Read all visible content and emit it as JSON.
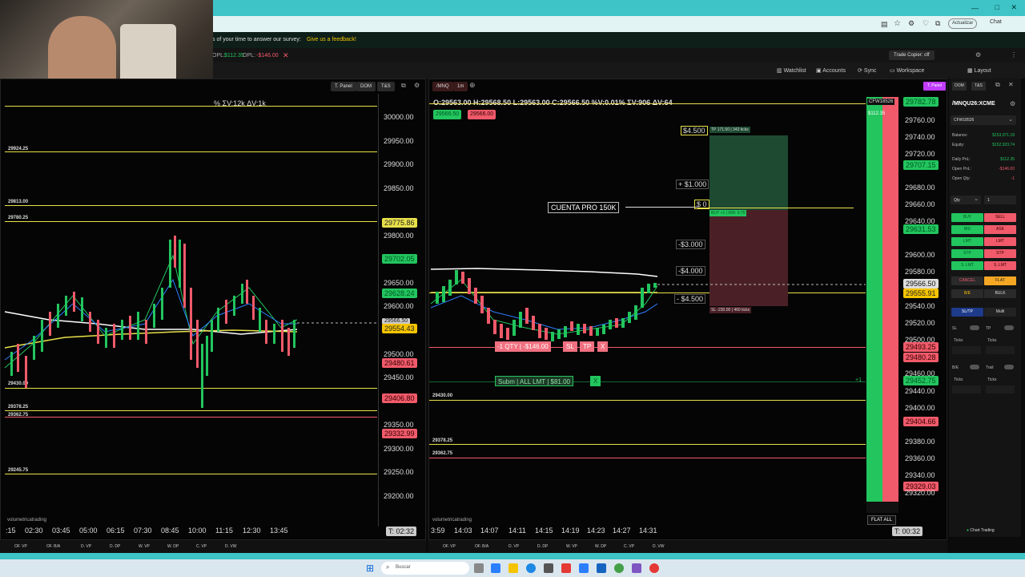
{
  "browser": {
    "update_label": "Actualizar",
    "chat_label": "Chat"
  },
  "banner": {
    "text": "s of your time to answer our survey:",
    "link": "Give us a feedback!"
  },
  "topbar": {
    "opl_label": "OPL:",
    "opl_value": "$112.35",
    "opl2_label": "OPL:",
    "opl2_value": "-$146.00",
    "trade_copier": "Trade Copier: off"
  },
  "nav": {
    "watchlist": "Watchlist",
    "accounts": "Accounts",
    "sync": "Sync",
    "workspace": "Workspace",
    "layout": "Layout"
  },
  "left_chart": {
    "buttons": [
      "T. Panel",
      "DOM",
      "T&S"
    ],
    "info": "% ΣV:12k ΔV:1k",
    "levels": [
      "29924.25",
      "29813.00",
      "29780.25",
      "29430.00",
      "29378.25",
      "29362.75",
      "29245.75"
    ],
    "ticks": [
      "30000.00",
      "29950.00",
      "29900.00",
      "29850.00",
      "29800.00",
      "29750.00",
      "29650.00",
      "29600.00",
      "29500.00",
      "29450.00",
      "29350.00",
      "29300.00",
      "29250.00",
      "29200.00"
    ],
    "tags": {
      "yellow": "29775.86",
      "green": "29702.05",
      "green2": "29628.24",
      "price": "29566.50",
      "gold": "29554.43",
      "red1": "29480.61",
      "red2": "29406.80",
      "red3": "29332.99"
    },
    "times": [
      ":15",
      "02:30",
      "03:45",
      "05:00",
      "06:15",
      "07:30",
      "08:45",
      "10:00",
      "11:15",
      "12:30",
      "13:45"
    ],
    "timer": "T: 02:32",
    "brand": "volumetricatrading",
    "bottom_tabs": [
      "OF. VP",
      "OF. B/A",
      "D. VP",
      "D. DP",
      "W. VP",
      "W. DP",
      "C. VP",
      "D. VW"
    ]
  },
  "right_chart": {
    "symbol": "/MNQ",
    "timeframe": "1m",
    "buttons": [
      "T. Panel",
      "DOM",
      "T&S"
    ],
    "ohlc": "O:29563.00 H:29568.50 L:29563.00 C:29566.50 %V:0.01% ΣV:906 ΔV:64",
    "bid": "29566.50",
    "ask": "29566.00",
    "levels_left": [
      "29430.00",
      "29378.25",
      "29362.75"
    ],
    "pnl_labels": [
      "$4.500",
      "+ $1.000",
      "$ 0",
      "-$3.000",
      "-$4.000",
      "- $4.500"
    ],
    "tp_label": "TP 171.50 | 343 ticks",
    "sl_label": "SL -230.00 | 460 ticks",
    "entry_label": "BUY +1 | R/R: 0.75",
    "account_label": "CUENTA PRO 150K",
    "position": "-1 QTY | -$146.00",
    "sl_btn": "SL",
    "tp_btn": "TP",
    "close_btn": "X",
    "order_label": "Subm | ALL LMT | $81.00",
    "order_close": "X",
    "plus1": "+1",
    "account_tag": "CFW18526",
    "pnl_tag": "$112.35",
    "flat_all": "FLAT ALL",
    "timer": "T: 00:32",
    "ticks": [
      "29760.00",
      "29740.00",
      "29720.00",
      "29680.00",
      "29660.00",
      "29640.00",
      "29600.00",
      "29580.00",
      "29540.00",
      "29520.00",
      "29500.00",
      "29460.00",
      "29440.00",
      "29400.00",
      "29380.00",
      "29360.00",
      "29340.00",
      "29320.00"
    ],
    "tags": {
      "top": "29782.78",
      "t2": "29707.15",
      "t3": "29631.53",
      "price": "29566.50",
      "gold": "29555.91",
      "r1": "29493.25",
      "r2": "29480.28",
      "g1": "29452.75",
      "r3": "29404.66",
      "r4": "29329.03"
    },
    "times": [
      "3:59",
      "14:03",
      "14:07",
      "14:11",
      "14:15",
      "14:19",
      "14:23",
      "14:27",
      "14:31"
    ],
    "brand": "volumetricatrading",
    "bottom_tabs": [
      "OF. VP",
      "OF. B/A",
      "D. VP",
      "D. DP",
      "W. VP",
      "W. DP",
      "C. VP",
      "D. VW"
    ]
  },
  "panel": {
    "buttons": [
      "T. Panel",
      "DOM",
      "T&S"
    ],
    "symbol": "/MNQU26:XCME",
    "account": "CFW18526",
    "rows": [
      {
        "label": "Balance:",
        "value": "$153,071.18"
      },
      {
        "label": "Equity:",
        "value": "$152,923.74"
      },
      {
        "label": "Daily PnL:",
        "value": "$112.35"
      },
      {
        "label": "Open PnL:",
        "value": "-$146.00"
      },
      {
        "label": "Open Qty:",
        "value": "-1"
      }
    ],
    "qty_label": "Qty",
    "qty_value": "1",
    "buy": "BUY",
    "sell": "SELL",
    "bid": "BID",
    "ask": "ASK",
    "lmt1": "LMT",
    "lmt2": "LMT",
    "stp1": "STP",
    "stp2": "STP",
    "slmt1": "S. LMT",
    "slmt2": "S. LMT",
    "cancel": "CANCEL",
    "flat": "FLAT",
    "be": "B/E",
    "bulk": "BULK",
    "sltp": "SL/TP",
    "multi": "Multi",
    "sl": "SL",
    "tp": "TP",
    "ticks1": "Ticks",
    "ticks2": "Ticks",
    "ticks3": "Ticks",
    "ticks4": "Ticks",
    "be_label": "B/E",
    "trail": "Trail",
    "chart_trading": "Chart Trading"
  },
  "taskbar": {
    "search": "Buscar"
  },
  "colors": {
    "green": "#22c55e",
    "red": "#f05a6a",
    "yellow": "#e8e04a",
    "gold": "#f5c400",
    "teal": "#3ec3c6"
  }
}
